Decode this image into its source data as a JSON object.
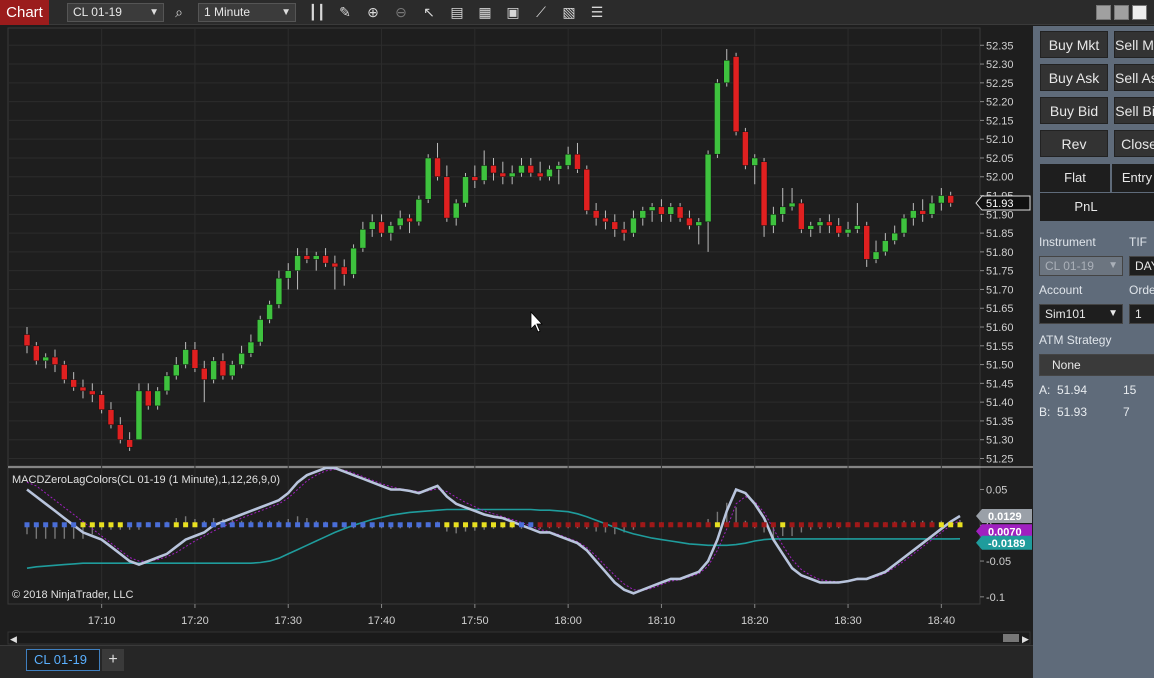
{
  "toolbar": {
    "chart_label": "Chart",
    "instrument": "CL 01-19",
    "interval": "1 Minute",
    "icons": [
      "search-icon",
      "bar-type-icon",
      "pencil-icon",
      "zoom-in-icon",
      "zoom-out-icon",
      "pointer-icon",
      "data-box-icon",
      "indicators-icon",
      "strategies-icon",
      "line-tool-icon",
      "properties-icon",
      "list-icon"
    ]
  },
  "price_axis": {
    "ticks": [
      "52.35",
      "52.30",
      "52.25",
      "52.20",
      "52.15",
      "52.10",
      "52.05",
      "52.00",
      "51.95",
      "51.90",
      "51.85",
      "51.80",
      "51.75",
      "51.70",
      "51.65",
      "51.60",
      "51.55",
      "51.50",
      "51.45",
      "51.40",
      "51.35",
      "51.30",
      "51.25"
    ],
    "last_price": "51.93"
  },
  "indicator": {
    "title": "MACDZeroLagColors(CL 01-19 (1 Minute),1,12,26,9,0)",
    "ticks": [
      "0.05",
      "0",
      "-0.05",
      "-0.1"
    ],
    "macd_value": "0.0129",
    "avg_value": "-0.0189",
    "hidden_value": "0.0070"
  },
  "copyright": "© 2018 NinjaTrader, LLC",
  "time_axis": [
    "17:10",
    "17:20",
    "17:30",
    "17:40",
    "17:50",
    "18:00",
    "18:10",
    "18:20",
    "18:30",
    "18:40"
  ],
  "tabs": {
    "active": "CL 01-19",
    "add": "+"
  },
  "trader": {
    "buy_mkt": "Buy Mkt",
    "sell_mkt": "Sell Mkt",
    "buy_ask": "Buy Ask",
    "sell_ask": "Sell Ask",
    "buy_bid": "Buy Bid",
    "sell_bid": "Sell Bid",
    "rev": "Rev",
    "close": "Close",
    "flat": "Flat",
    "entry": "Entry",
    "pnl": "PnL",
    "instrument_label": "Instrument",
    "tif_label": "TIF",
    "instrument_value": "CL 01-19",
    "tif_value": "DAY",
    "account_label": "Account",
    "order_label": "Order qty",
    "account_value": "Sim101",
    "order_value": "1",
    "atm_label": "ATM Strategy",
    "atm_value": "None",
    "ask_label": "A:",
    "ask_price": "51.94",
    "ask_size": "15",
    "bid_label": "B:",
    "bid_price": "51.93",
    "bid_size": "7"
  },
  "colors": {
    "up": "#3ec23e",
    "down": "#e02020",
    "macd": "#b8c4dc",
    "avg": "#1f9c9c",
    "signal": "#a020c0",
    "accent_red": "#9b1c1c"
  },
  "chart_data": {
    "type": "candlestick",
    "instrument": "CL 01-19",
    "interval": "1 Minute",
    "x_start": "17:02",
    "x_interval_minutes": 1,
    "ylim": [
      51.23,
      52.38
    ],
    "candles": [
      {
        "o": 51.58,
        "h": 51.6,
        "l": 51.53,
        "c": 51.55
      },
      {
        "o": 51.55,
        "h": 51.56,
        "l": 51.5,
        "c": 51.51
      },
      {
        "o": 51.51,
        "h": 51.53,
        "l": 51.49,
        "c": 51.52
      },
      {
        "o": 51.52,
        "h": 51.54,
        "l": 51.48,
        "c": 51.5
      },
      {
        "o": 51.5,
        "h": 51.51,
        "l": 51.45,
        "c": 51.46
      },
      {
        "o": 51.46,
        "h": 51.48,
        "l": 51.43,
        "c": 51.44
      },
      {
        "o": 51.44,
        "h": 51.46,
        "l": 51.41,
        "c": 51.43
      },
      {
        "o": 51.43,
        "h": 51.45,
        "l": 51.4,
        "c": 51.42
      },
      {
        "o": 51.42,
        "h": 51.43,
        "l": 51.37,
        "c": 51.38
      },
      {
        "o": 51.38,
        "h": 51.4,
        "l": 51.33,
        "c": 51.34
      },
      {
        "o": 51.34,
        "h": 51.36,
        "l": 51.29,
        "c": 51.3
      },
      {
        "o": 51.3,
        "h": 51.32,
        "l": 51.27,
        "c": 51.28
      },
      {
        "o": 51.3,
        "h": 51.45,
        "l": 51.3,
        "c": 51.43
      },
      {
        "o": 51.43,
        "h": 51.45,
        "l": 51.38,
        "c": 51.39
      },
      {
        "o": 51.39,
        "h": 51.44,
        "l": 51.38,
        "c": 51.43
      },
      {
        "o": 51.43,
        "h": 51.48,
        "l": 51.42,
        "c": 51.47
      },
      {
        "o": 51.47,
        "h": 51.52,
        "l": 51.46,
        "c": 51.5
      },
      {
        "o": 51.5,
        "h": 51.56,
        "l": 51.49,
        "c": 51.54
      },
      {
        "o": 51.54,
        "h": 51.56,
        "l": 51.48,
        "c": 51.49
      },
      {
        "o": 51.49,
        "h": 51.51,
        "l": 51.4,
        "c": 51.46
      },
      {
        "o": 51.46,
        "h": 51.52,
        "l": 51.45,
        "c": 51.51
      },
      {
        "o": 51.51,
        "h": 51.53,
        "l": 51.46,
        "c": 51.47
      },
      {
        "o": 51.47,
        "h": 51.51,
        "l": 51.46,
        "c": 51.5
      },
      {
        "o": 51.5,
        "h": 51.55,
        "l": 51.49,
        "c": 51.53
      },
      {
        "o": 51.53,
        "h": 51.58,
        "l": 51.52,
        "c": 51.56
      },
      {
        "o": 51.56,
        "h": 51.63,
        "l": 51.55,
        "c": 51.62
      },
      {
        "o": 51.62,
        "h": 51.67,
        "l": 51.61,
        "c": 51.66
      },
      {
        "o": 51.66,
        "h": 51.75,
        "l": 51.65,
        "c": 51.73
      },
      {
        "o": 51.73,
        "h": 51.77,
        "l": 51.7,
        "c": 51.75
      },
      {
        "o": 51.75,
        "h": 51.81,
        "l": 51.7,
        "c": 51.79
      },
      {
        "o": 51.79,
        "h": 51.81,
        "l": 51.77,
        "c": 51.78
      },
      {
        "o": 51.78,
        "h": 51.8,
        "l": 51.75,
        "c": 51.79
      },
      {
        "o": 51.79,
        "h": 51.81,
        "l": 51.76,
        "c": 51.77
      },
      {
        "o": 51.77,
        "h": 51.79,
        "l": 51.7,
        "c": 51.76
      },
      {
        "o": 51.76,
        "h": 51.78,
        "l": 51.71,
        "c": 51.74
      },
      {
        "o": 51.74,
        "h": 51.82,
        "l": 51.73,
        "c": 51.81
      },
      {
        "o": 51.81,
        "h": 51.88,
        "l": 51.8,
        "c": 51.86
      },
      {
        "o": 51.86,
        "h": 51.9,
        "l": 51.84,
        "c": 51.88
      },
      {
        "o": 51.88,
        "h": 51.9,
        "l": 51.84,
        "c": 51.85
      },
      {
        "o": 51.85,
        "h": 51.88,
        "l": 51.83,
        "c": 51.87
      },
      {
        "o": 51.87,
        "h": 51.91,
        "l": 51.86,
        "c": 51.89
      },
      {
        "o": 51.89,
        "h": 51.9,
        "l": 51.85,
        "c": 51.88
      },
      {
        "o": 51.88,
        "h": 51.95,
        "l": 51.87,
        "c": 51.94
      },
      {
        "o": 51.94,
        "h": 52.06,
        "l": 51.93,
        "c": 52.05
      },
      {
        "o": 52.05,
        "h": 52.09,
        "l": 51.99,
        "c": 52.0
      },
      {
        "o": 52.0,
        "h": 52.03,
        "l": 51.88,
        "c": 51.89
      },
      {
        "o": 51.89,
        "h": 51.94,
        "l": 51.87,
        "c": 51.93
      },
      {
        "o": 51.93,
        "h": 52.01,
        "l": 51.92,
        "c": 52.0
      },
      {
        "o": 52.0,
        "h": 52.03,
        "l": 51.97,
        "c": 51.99
      },
      {
        "o": 51.99,
        "h": 52.07,
        "l": 51.98,
        "c": 52.03
      },
      {
        "o": 52.03,
        "h": 52.05,
        "l": 51.99,
        "c": 52.01
      },
      {
        "o": 52.01,
        "h": 52.04,
        "l": 51.98,
        "c": 52.0
      },
      {
        "o": 52.0,
        "h": 52.03,
        "l": 51.98,
        "c": 52.01
      },
      {
        "o": 52.01,
        "h": 52.05,
        "l": 52.0,
        "c": 52.03
      },
      {
        "o": 52.03,
        "h": 52.05,
        "l": 52.0,
        "c": 52.01
      },
      {
        "o": 52.01,
        "h": 52.04,
        "l": 51.99,
        "c": 52.0
      },
      {
        "o": 52.0,
        "h": 52.03,
        "l": 51.99,
        "c": 52.02
      },
      {
        "o": 52.02,
        "h": 52.04,
        "l": 51.98,
        "c": 52.03
      },
      {
        "o": 52.03,
        "h": 52.08,
        "l": 52.02,
        "c": 52.06
      },
      {
        "o": 52.06,
        "h": 52.09,
        "l": 52.01,
        "c": 52.02
      },
      {
        "o": 52.02,
        "h": 52.03,
        "l": 51.9,
        "c": 51.91
      },
      {
        "o": 51.91,
        "h": 51.93,
        "l": 51.87,
        "c": 51.89
      },
      {
        "o": 51.89,
        "h": 51.91,
        "l": 51.86,
        "c": 51.88
      },
      {
        "o": 51.88,
        "h": 51.9,
        "l": 51.84,
        "c": 51.86
      },
      {
        "o": 51.86,
        "h": 51.88,
        "l": 51.83,
        "c": 51.85
      },
      {
        "o": 51.85,
        "h": 51.91,
        "l": 51.84,
        "c": 51.89
      },
      {
        "o": 51.89,
        "h": 51.92,
        "l": 51.87,
        "c": 51.91
      },
      {
        "o": 51.91,
        "h": 51.93,
        "l": 51.88,
        "c": 51.92
      },
      {
        "o": 51.92,
        "h": 51.94,
        "l": 51.88,
        "c": 51.9
      },
      {
        "o": 51.9,
        "h": 51.93,
        "l": 51.88,
        "c": 51.92
      },
      {
        "o": 51.92,
        "h": 51.93,
        "l": 51.88,
        "c": 51.89
      },
      {
        "o": 51.89,
        "h": 51.91,
        "l": 51.86,
        "c": 51.87
      },
      {
        "o": 51.87,
        "h": 51.89,
        "l": 51.82,
        "c": 51.88
      },
      {
        "o": 51.88,
        "h": 52.07,
        "l": 51.8,
        "c": 52.06
      },
      {
        "o": 52.06,
        "h": 52.26,
        "l": 52.05,
        "c": 52.25
      },
      {
        "o": 52.25,
        "h": 52.34,
        "l": 52.24,
        "c": 52.31
      },
      {
        "o": 52.32,
        "h": 52.33,
        "l": 52.11,
        "c": 52.12
      },
      {
        "o": 52.12,
        "h": 52.13,
        "l": 52.02,
        "c": 52.03
      },
      {
        "o": 52.03,
        "h": 52.06,
        "l": 51.98,
        "c": 52.05
      },
      {
        "o": 52.04,
        "h": 52.05,
        "l": 51.84,
        "c": 51.87
      },
      {
        "o": 51.87,
        "h": 51.92,
        "l": 51.85,
        "c": 51.9
      },
      {
        "o": 51.9,
        "h": 51.97,
        "l": 51.88,
        "c": 51.92
      },
      {
        "o": 51.92,
        "h": 51.97,
        "l": 51.91,
        "c": 51.93
      },
      {
        "o": 51.93,
        "h": 51.94,
        "l": 51.85,
        "c": 51.86
      },
      {
        "o": 51.86,
        "h": 51.88,
        "l": 51.84,
        "c": 51.87
      },
      {
        "o": 51.87,
        "h": 51.89,
        "l": 51.85,
        "c": 51.88
      },
      {
        "o": 51.88,
        "h": 51.9,
        "l": 51.85,
        "c": 51.87
      },
      {
        "o": 51.87,
        "h": 51.89,
        "l": 51.84,
        "c": 51.85
      },
      {
        "o": 51.85,
        "h": 51.88,
        "l": 51.84,
        "c": 51.86
      },
      {
        "o": 51.86,
        "h": 51.93,
        "l": 51.85,
        "c": 51.87
      },
      {
        "o": 51.87,
        "h": 51.88,
        "l": 51.76,
        "c": 51.78
      },
      {
        "o": 51.78,
        "h": 51.83,
        "l": 51.77,
        "c": 51.8
      },
      {
        "o": 51.8,
        "h": 51.85,
        "l": 51.79,
        "c": 51.83
      },
      {
        "o": 51.83,
        "h": 51.87,
        "l": 51.82,
        "c": 51.85
      },
      {
        "o": 51.85,
        "h": 51.9,
        "l": 51.84,
        "c": 51.89
      },
      {
        "o": 51.89,
        "h": 51.93,
        "l": 51.87,
        "c": 51.91
      },
      {
        "o": 51.91,
        "h": 51.94,
        "l": 51.88,
        "c": 51.9
      },
      {
        "o": 51.9,
        "h": 51.95,
        "l": 51.89,
        "c": 51.93
      },
      {
        "o": 51.93,
        "h": 51.97,
        "l": 51.91,
        "c": 51.95
      },
      {
        "o": 51.95,
        "h": 51.96,
        "l": 51.92,
        "c": 51.93
      }
    ],
    "macd_ylim": [
      -0.11,
      0.08
    ],
    "macd": [
      0.05,
      0.04,
      0.03,
      0.02,
      0.01,
      0.0,
      -0.01,
      -0.015,
      -0.02,
      -0.03,
      -0.04,
      -0.05,
      -0.055,
      -0.05,
      -0.045,
      -0.04,
      -0.03,
      -0.02,
      -0.015,
      -0.01,
      0.0,
      0.005,
      0.01,
      0.015,
      0.02,
      0.025,
      0.03,
      0.035,
      0.045,
      0.06,
      0.07,
      0.075,
      0.08,
      0.08,
      0.075,
      0.07,
      0.065,
      0.06,
      0.055,
      0.05,
      0.05,
      0.048,
      0.045,
      0.05,
      0.055,
      0.04,
      0.03,
      0.025,
      0.02,
      0.015,
      0.012,
      0.01,
      0.005,
      0.0,
      -0.005,
      -0.01,
      -0.01,
      -0.015,
      -0.02,
      -0.025,
      -0.035,
      -0.05,
      -0.065,
      -0.08,
      -0.09,
      -0.095,
      -0.09,
      -0.085,
      -0.08,
      -0.075,
      -0.075,
      -0.07,
      -0.065,
      -0.05,
      -0.02,
      0.02,
      0.05,
      0.045,
      0.03,
      0.01,
      -0.02,
      -0.04,
      -0.06,
      -0.07,
      -0.075,
      -0.08,
      -0.08,
      -0.08,
      -0.078,
      -0.075,
      -0.075,
      -0.07,
      -0.065,
      -0.055,
      -0.045,
      -0.035,
      -0.025,
      -0.015,
      -0.005,
      0.005,
      0.0129
    ],
    "signal": [
      0.06,
      0.055,
      0.045,
      0.035,
      0.025,
      0.015,
      0.005,
      -0.005,
      -0.015,
      -0.025,
      -0.035,
      -0.045,
      -0.05,
      -0.05,
      -0.048,
      -0.044,
      -0.038,
      -0.03,
      -0.022,
      -0.015,
      -0.008,
      -0.002,
      0.004,
      0.01,
      0.015,
      0.02,
      0.025,
      0.03,
      0.038,
      0.05,
      0.062,
      0.07,
      0.076,
      0.078,
      0.077,
      0.073,
      0.068,
      0.063,
      0.058,
      0.054,
      0.051,
      0.049,
      0.047,
      0.048,
      0.051,
      0.047,
      0.039,
      0.032,
      0.026,
      0.02,
      0.016,
      0.012,
      0.008,
      0.004,
      -0.001,
      -0.006,
      -0.009,
      -0.013,
      -0.018,
      -0.023,
      -0.031,
      -0.043,
      -0.057,
      -0.07,
      -0.082,
      -0.09,
      -0.091,
      -0.088,
      -0.083,
      -0.078,
      -0.076,
      -0.072,
      -0.068,
      -0.057,
      -0.035,
      -0.005,
      0.03,
      0.04,
      0.033,
      0.018,
      -0.005,
      -0.028,
      -0.048,
      -0.062,
      -0.07,
      -0.076,
      -0.078,
      -0.079,
      -0.078,
      -0.076,
      -0.075,
      -0.072,
      -0.067,
      -0.059,
      -0.05,
      -0.04,
      -0.03,
      -0.02,
      -0.01,
      0.0,
      0.007
    ],
    "avg": [
      -0.06,
      -0.058,
      -0.057,
      -0.056,
      -0.055,
      -0.054,
      -0.053,
      -0.053,
      -0.053,
      -0.053,
      -0.053,
      -0.053,
      -0.053,
      -0.053,
      -0.053,
      -0.053,
      -0.053,
      -0.053,
      -0.053,
      -0.053,
      -0.053,
      -0.053,
      -0.053,
      -0.053,
      -0.053,
      -0.052,
      -0.05,
      -0.046,
      -0.04,
      -0.034,
      -0.028,
      -0.022,
      -0.016,
      -0.01,
      -0.005,
      0.0,
      0.004,
      0.008,
      0.011,
      0.014,
      0.016,
      0.018,
      0.019,
      0.02,
      0.021,
      0.022,
      0.022,
      0.022,
      0.022,
      0.022,
      0.022,
      0.022,
      0.022,
      0.022,
      0.022,
      0.021,
      0.021,
      0.02,
      0.019,
      0.016,
      0.012,
      0.007,
      0.002,
      -0.003,
      -0.008,
      -0.012,
      -0.015,
      -0.018,
      -0.02,
      -0.022,
      -0.024,
      -0.026,
      -0.027,
      -0.028,
      -0.028,
      -0.028,
      -0.027,
      -0.025,
      -0.022,
      -0.02,
      -0.019,
      -0.019,
      -0.019,
      -0.019,
      -0.019,
      -0.019,
      -0.019,
      -0.019,
      -0.019,
      -0.019,
      -0.019,
      -0.019,
      -0.019,
      -0.019,
      -0.019,
      -0.019,
      -0.019,
      -0.019,
      -0.019,
      -0.019,
      -0.0189
    ]
  }
}
